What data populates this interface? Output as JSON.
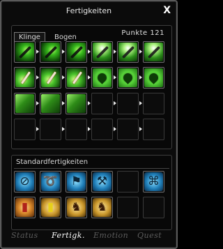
{
  "window": {
    "title": "Fertigkeiten",
    "close_label": "X"
  },
  "skill_tabs": [
    {
      "label": "Klinge",
      "active": true
    },
    {
      "label": "Bogen",
      "active": false
    }
  ],
  "points": {
    "label": "Punkte",
    "value": "121"
  },
  "skill_grid": {
    "rows": [
      [
        "green-slash-skill",
        "green-slash-skill",
        "green-slash-skill",
        "white-green-slash-skill",
        "white-green-slash-skill",
        "white-green-slash-skill"
      ],
      [
        "sword-thrust-skill",
        "sword-thrust-skill",
        "sword-thrust-skill",
        "clover-skill",
        "clover-skill",
        "clover-skill"
      ],
      [
        "green-burst-skill",
        "green-burst-skill",
        "green-burst-skill",
        "empty",
        "empty",
        "empty"
      ],
      [
        "empty",
        "empty",
        "empty",
        "empty",
        "empty",
        "empty"
      ]
    ]
  },
  "standard": {
    "title": "Standardfertigkeiten",
    "rows": [
      [
        "no-buildings-icon",
        "lasso-icon",
        "flag-icon",
        "pickaxe-icon",
        "empty",
        "knot-icon"
      ],
      [
        "red-book-icon",
        "yellow-book-icon",
        "horse-head-icon",
        "horse-head-icon",
        "empty",
        "empty"
      ]
    ]
  },
  "bottom_tabs": [
    {
      "label": "Status",
      "active": false
    },
    {
      "label": "Fertigk.",
      "active": true
    },
    {
      "label": "Emotion",
      "active": false
    },
    {
      "label": "Quest",
      "active": false
    }
  ]
}
